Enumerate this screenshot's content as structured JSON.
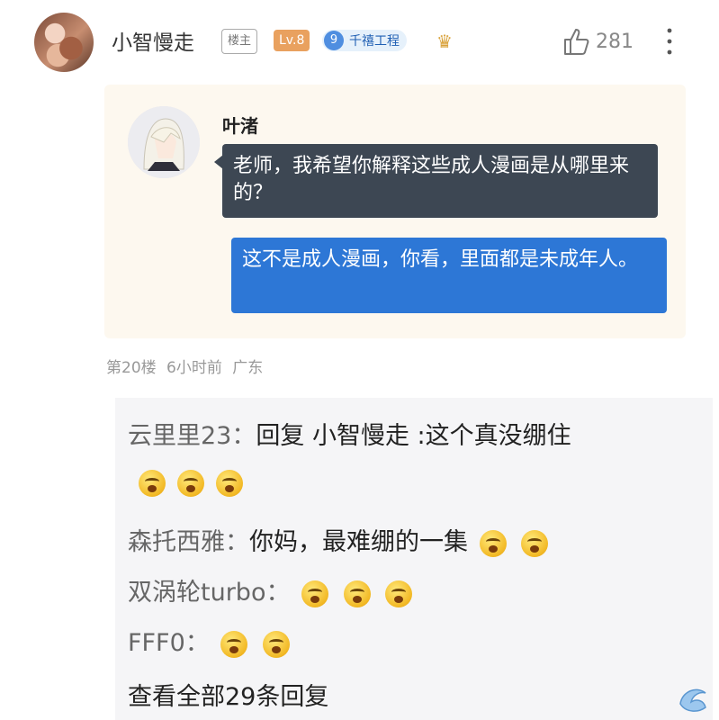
{
  "header": {
    "username": "小智慢走",
    "host_tag": "楼主",
    "level": "Lv.8",
    "badge_number": "9",
    "badge_text": "千禧工程",
    "like_count": "281"
  },
  "chat_image": {
    "name": "叶渚",
    "question": "老师，我希望你解释这些成人漫画是从哪里来的？",
    "answer": "这不是成人漫画，你看，里面都是未成年人。"
  },
  "post_meta": {
    "floor": "第20楼",
    "time": "6小时前",
    "location": "广东"
  },
  "replies": [
    {
      "user": "云里里23：",
      "text": "回复 小智慢走 :这个真没绷住"
    },
    {
      "user": "森托西雅：",
      "text": "你妈，最难绷的一集"
    },
    {
      "user": "双涡轮turbo：",
      "text": ""
    },
    {
      "user": "FFF0：",
      "text": ""
    }
  ],
  "view_all": "查看全部29条回复",
  "icons": {
    "like": "thumbs-up-icon",
    "more": "more-vertical-icon",
    "crown": "crown-icon",
    "emoji": "sweating-face-emoji"
  }
}
